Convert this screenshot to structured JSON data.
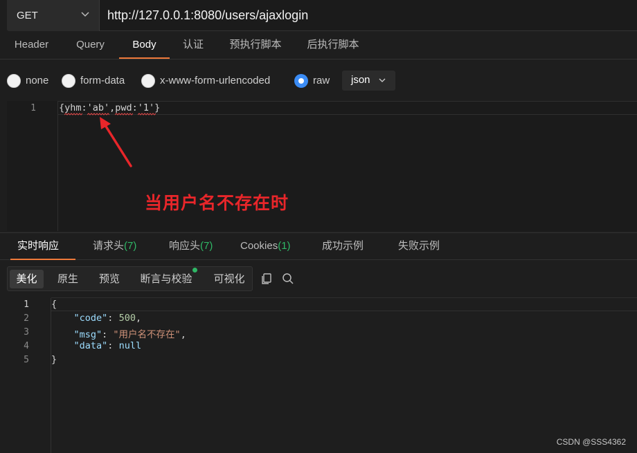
{
  "request": {
    "method": "GET",
    "url": "http://127.0.0.1:8080/users/ajaxlogin"
  },
  "request_tabs": [
    "Header",
    "Query",
    "Body",
    "认证",
    "预执行脚本",
    "后执行脚本"
  ],
  "active_request_tab": "Body",
  "body_types": [
    "none",
    "form-data",
    "x-www-form-urlencoded",
    "raw"
  ],
  "selected_body_type": "raw",
  "format_select": "json",
  "request_editor": {
    "line_number": "1",
    "code_line": "{yhm:'ab',pwd:'1'}"
  },
  "annotation": "当用户名不存在时",
  "response_tabs": {
    "realtime": "实时响应",
    "req_headers": "请求头",
    "req_headers_count": "(7)",
    "resp_headers": "响应头",
    "resp_headers_count": "(7)",
    "cookies": "Cookies",
    "cookies_count": "(1)",
    "success_example": "成功示例",
    "fail_example": "失败示例"
  },
  "view_modes": [
    "美化",
    "原生",
    "预览",
    "断言与校验",
    "可视化"
  ],
  "active_view_mode": "美化",
  "response_editor": {
    "line_numbers": [
      "1",
      "2",
      "3",
      "4",
      "5"
    ],
    "open_brace": "{",
    "code_key": "\"code\"",
    "code_value": "500",
    "msg_key": "\"msg\"",
    "msg_value": "\"用户名不存在\"",
    "data_key": "\"data\"",
    "data_value": "null",
    "close_brace": "}"
  },
  "watermark": "CSDN @SSS4362",
  "colors": {
    "accent_tab": "#f07a3a",
    "radio_checked": "#3b8cf5",
    "count_green": "#2fb866",
    "annotation_red": "#e8262a"
  }
}
